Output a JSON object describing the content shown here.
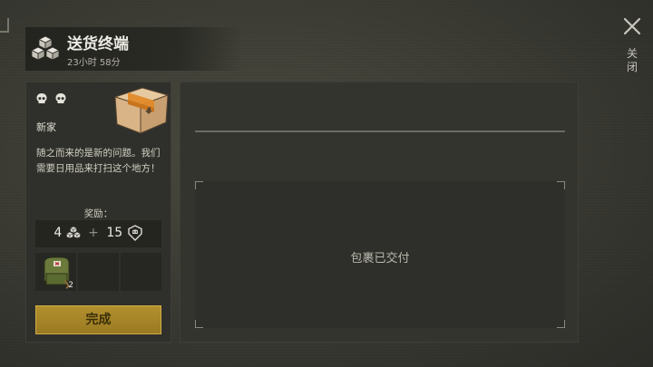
{
  "header": {
    "title": "送货终端",
    "timer": "23小时 58分",
    "icon": "boxes-icon"
  },
  "close": {
    "label": "关闭",
    "icon": "close-icon"
  },
  "quest": {
    "difficulty_icons": [
      "skull-icon",
      "skull-icon"
    ],
    "image": "cardboard-crate-icon",
    "name": "新家",
    "description": "随之而来的是新的问题。我们需要日用品来打扫这个地方！",
    "reward_label": "奖励：",
    "reward_amount_1": "4",
    "reward_icon_1": "boxes-icon",
    "plus": "+",
    "reward_amount_2": "15",
    "reward_icon_2": "shield-icon",
    "items": [
      {
        "icon": "backpack-icon",
        "count": "2"
      }
    ],
    "complete_label": "完成"
  },
  "delivery": {
    "status": "包裹已交付"
  },
  "colors": {
    "accent": "#b2902e",
    "panel": "#2f302b",
    "background": "#3a3a33"
  }
}
